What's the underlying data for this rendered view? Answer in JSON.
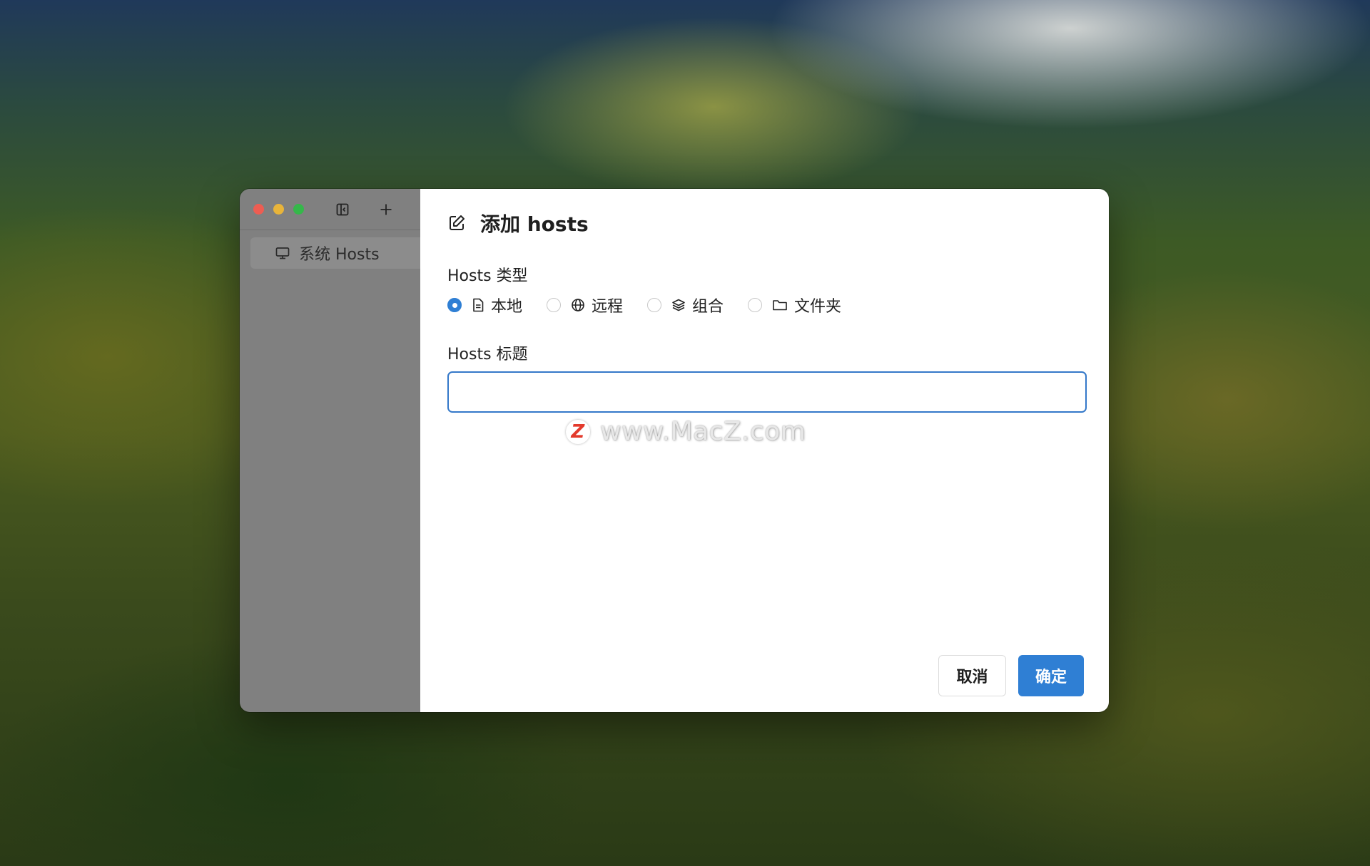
{
  "window": {
    "sidebar": {
      "items": [
        {
          "label": "系统 Hosts",
          "icon": "monitor-icon"
        }
      ]
    },
    "dialog": {
      "title": "添加 hosts",
      "type_label": "Hosts 类型",
      "type_options": [
        {
          "label": "本地",
          "icon": "file-icon",
          "selected": true
        },
        {
          "label": "远程",
          "icon": "globe-icon",
          "selected": false
        },
        {
          "label": "组合",
          "icon": "layers-icon",
          "selected": false
        },
        {
          "label": "文件夹",
          "icon": "folder-icon",
          "selected": false
        }
      ],
      "title_label": "Hosts 标题",
      "title_value": "",
      "title_placeholder": "",
      "cancel_label": "取消",
      "ok_label": "确定"
    }
  },
  "watermark": {
    "logo_letter": "Z",
    "text": "www.MacZ.com"
  },
  "colors": {
    "accent": "#2f7fd4",
    "sidebar_bg": "#808080",
    "close": "#ee5d52",
    "minimize": "#e8b43a",
    "maximize": "#35b84a"
  }
}
